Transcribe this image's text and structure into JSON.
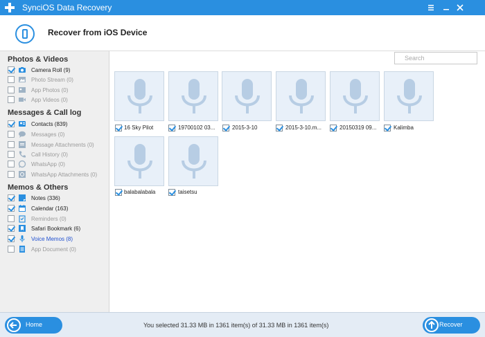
{
  "window": {
    "title": "SynciOS Data Recovery"
  },
  "header": {
    "title": "Recover from iOS Device"
  },
  "search": {
    "placeholder": "Search"
  },
  "sidebar": {
    "sections": [
      {
        "title": "Photos & Videos",
        "items": [
          {
            "label": "Camera Roll (9)",
            "checked": true,
            "state": "enabled",
            "icon": "camera-icon"
          },
          {
            "label": "Photo Stream (0)",
            "checked": false,
            "state": "disabled",
            "icon": "photo-stream-icon"
          },
          {
            "label": "App Photos (0)",
            "checked": false,
            "state": "disabled",
            "icon": "app-photos-icon"
          },
          {
            "label": "App Videos (0)",
            "checked": false,
            "state": "disabled",
            "icon": "video-camera-icon"
          }
        ]
      },
      {
        "title": "Messages & Call log",
        "items": [
          {
            "label": "Contacts (839)",
            "checked": true,
            "state": "enabled",
            "icon": "contacts-icon"
          },
          {
            "label": "Messages (0)",
            "checked": false,
            "state": "disabled",
            "icon": "message-bubble-icon"
          },
          {
            "label": "Message Attachments (0)",
            "checked": false,
            "state": "disabled",
            "icon": "attachment-icon"
          },
          {
            "label": "Call History (0)",
            "checked": false,
            "state": "disabled",
            "icon": "phone-icon"
          },
          {
            "label": "WhatsApp (0)",
            "checked": false,
            "state": "disabled",
            "icon": "whatsapp-icon"
          },
          {
            "label": "WhatsApp Attachments (0)",
            "checked": false,
            "state": "disabled",
            "icon": "whatsapp-attachment-icon"
          }
        ]
      },
      {
        "title": "Memos & Others",
        "items": [
          {
            "label": "Notes (336)",
            "checked": true,
            "state": "enabled",
            "icon": "notes-icon"
          },
          {
            "label": "Calendar (163)",
            "checked": true,
            "state": "enabled",
            "icon": "calendar-icon"
          },
          {
            "label": "Reminders (0)",
            "checked": false,
            "state": "disabled",
            "icon": "reminders-icon"
          },
          {
            "label": "Safari Bookmark (6)",
            "checked": true,
            "state": "enabled",
            "icon": "bookmark-icon"
          },
          {
            "label": "Voice Memos (8)",
            "checked": true,
            "state": "selected",
            "icon": "microphone-icon"
          },
          {
            "label": "App Document (0)",
            "checked": false,
            "state": "disabled",
            "icon": "document-icon"
          }
        ]
      }
    ]
  },
  "files": [
    {
      "name": "16 Sky Pilot",
      "checked": true
    },
    {
      "name": "19700102 03...",
      "checked": true
    },
    {
      "name": "2015-3-10",
      "checked": true
    },
    {
      "name": "2015-3-10.m...",
      "checked": true
    },
    {
      "name": "20150319 09...",
      "checked": true
    },
    {
      "name": "Kalimba",
      "checked": true
    },
    {
      "name": "balabalabala",
      "checked": true
    },
    {
      "name": "taisetsu",
      "checked": true
    }
  ],
  "footer": {
    "home_label": "Home",
    "recover_label": "Recover",
    "status": "You selected 31.33 MB in 1361 item(s) of 31.33 MB in 1361 item(s)"
  },
  "colors": {
    "accent": "#2a8fe0",
    "selected_text": "#1f4fd0",
    "tile_bg": "#e8f0f9",
    "mic": "#b7cde4"
  }
}
